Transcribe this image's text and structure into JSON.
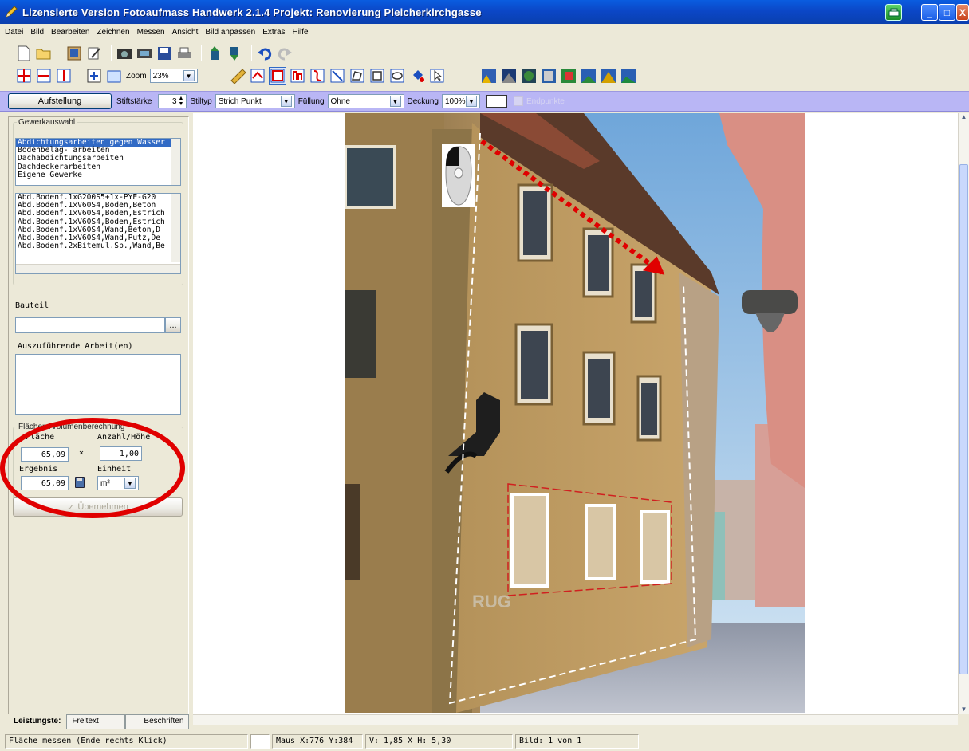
{
  "window": {
    "title": "Lizensierte Version Fotoaufmass Handwerk 2.1.4   Projekt: Renovierung Pleicherkirchgasse",
    "minimize": "_",
    "maximize": "□",
    "close": "X"
  },
  "menu": [
    "Datei",
    "Bild",
    "Bearbeiten",
    "Zeichnen",
    "Messen",
    "Ansicht",
    "Bild anpassen",
    "Extras",
    "Hilfe"
  ],
  "toolbar": {
    "zoom_label": "Zoom",
    "zoom_value": "23%"
  },
  "drawbar": {
    "aufstellung": "Aufstellung",
    "stiftstaerke_label": "Stiftstärke",
    "stiftstaerke_value": "3",
    "stiltyp_label": "Stiltyp",
    "stiltyp_value": "Strich Punkt",
    "fuellung_label": "Füllung",
    "fuellung_value": "Ohne",
    "deckung_label": "Deckung",
    "deckung_value": "100%",
    "endpunkte_label": "Endpunkte"
  },
  "gewerk": {
    "legend": "Gewerkauswahl",
    "items": [
      "Abdichtungsarbeiten gegen Wasser",
      "Bodenbelag- arbeiten",
      "Dachabdichtungsarbeiten",
      "Dachdeckerarbeiten",
      "Eigene Gewerke"
    ],
    "positions": [
      "Abd.Bodenf.1xG200S5+1x-PYE-G20",
      "Abd.Bodenf.1xV60S4,Boden,Beton",
      "Abd.Bodenf.1xV60S4,Boden,Estrich",
      "Abd.Bodenf.1xV60S4,Boden,Estrich",
      "Abd.Bodenf.1xV60S4,Wand,Beton,D",
      "Abd.Bodenf.1xV60S4,Wand,Putz,De",
      "Abd.Bodenf.2xBitemul.Sp.,Wand,Be"
    ]
  },
  "bauteil": {
    "label": "Bauteil",
    "value": "",
    "browse": "...",
    "arbeit_label": "Auszuführende Arbeit(en)"
  },
  "berechnung": {
    "legend": "Flächen-/Volumenberechnung",
    "flaeche_label": "Fläche",
    "flaeche_value": "65,09",
    "mal": "×",
    "anzahl_label": "Anzahl/Höhe",
    "anzahl_value": "1,00",
    "ergebnis_label": "Ergebnis",
    "ergebnis_value": "65,09",
    "einheit_label": "Einheit",
    "einheit_value": "m²",
    "uebernehmen": "Übernehmen"
  },
  "tabs": [
    "Leistungste:",
    "Freitext",
    "Beschriften"
  ],
  "status": {
    "hint": "Fläche messen (Ende rechts Klick)",
    "maus": "Maus X:776 Y:384",
    "dim": "V: 1,85 X H: 5,30",
    "bild": "Bild: 1 von 1"
  },
  "colors": {
    "title_blue": "#0b47c7",
    "drawbar": "#b9b6f5",
    "annotation_red": "#e00000",
    "selection": "#316ac5"
  }
}
